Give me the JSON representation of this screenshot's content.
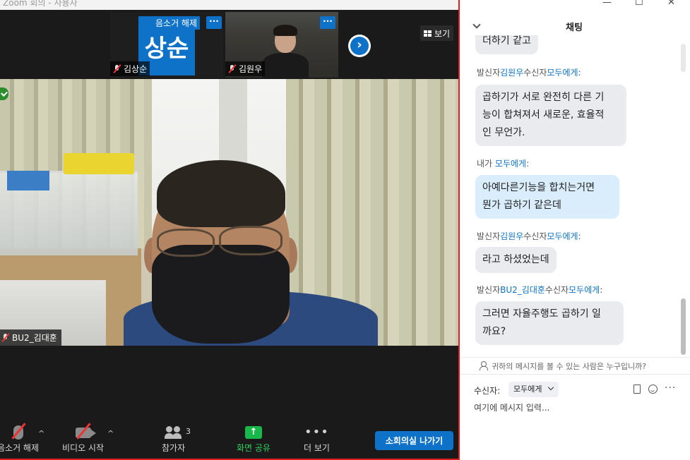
{
  "window": {
    "title": "Zoom 회의 - 사용자"
  },
  "strip": {
    "tile1": {
      "avatar_text": "상순",
      "unmute_label": "음소거 해제",
      "name": "김상순"
    },
    "tile2": {
      "name": "김원우"
    },
    "more_glyph": "···",
    "next_glyph": "›",
    "view_label": "보기"
  },
  "main_video": {
    "name": "BU2_김대훈"
  },
  "toolbar": {
    "unmute_label": "음소거 해제",
    "video_label": "비디오 시작",
    "participants_label": "참가자",
    "participants_count": "3",
    "share_label": "화면 공유",
    "more_label": "더 보기",
    "leave_label": "소회의실 나가기",
    "caret": "^",
    "share_arrow": "↑",
    "more_dots": "•••"
  },
  "chat": {
    "title": "채팅",
    "messages": [
      {
        "meta_sender_prefix": "",
        "text_lines": [
          "더하기 같고"
        ]
      },
      {
        "meta_prefix": "발신자",
        "sender": "김원우",
        "mid": "수신자",
        "recipient": "모두에게",
        "suffix": ":",
        "text_lines": [
          "곱하기가 서로 완전히 다른 기",
          "능이 합쳐져서 새로운, 효율적",
          "인 무언가."
        ]
      },
      {
        "meta_prefix": "내가 ",
        "recipient": "모두에게",
        "suffix": ":",
        "text_lines": [
          "아예다른기능을 합치는거면",
          "뭔가 곱하기 같은데"
        ]
      },
      {
        "meta_prefix": "발신자",
        "sender": "김원우",
        "mid": "수신자",
        "recipient": "모두에게",
        "suffix": ":",
        "text_lines": [
          "라고 하셨었는데"
        ]
      },
      {
        "meta_prefix": "발신자",
        "sender": "BU2_김대훈",
        "mid": "수신자",
        "recipient": "모두에게",
        "suffix": ":",
        "text_lines": [
          "그러면 자율주행도 곱하기 일",
          "까요?"
        ]
      }
    ],
    "who_can_see": "귀하의 메시지를 볼 수 있는 사람은 누구입니까?",
    "to_label": "수신자:",
    "to_value": "모두에게",
    "input_placeholder": "여기에 메시지 입력...",
    "more_glyph": "···"
  },
  "window_controls": {
    "minimize": "—",
    "maximize": "☐",
    "close": "✕"
  },
  "colors": {
    "accent": "#0e72c9",
    "share_green": "#18b84a",
    "border_red": "#e02020"
  }
}
